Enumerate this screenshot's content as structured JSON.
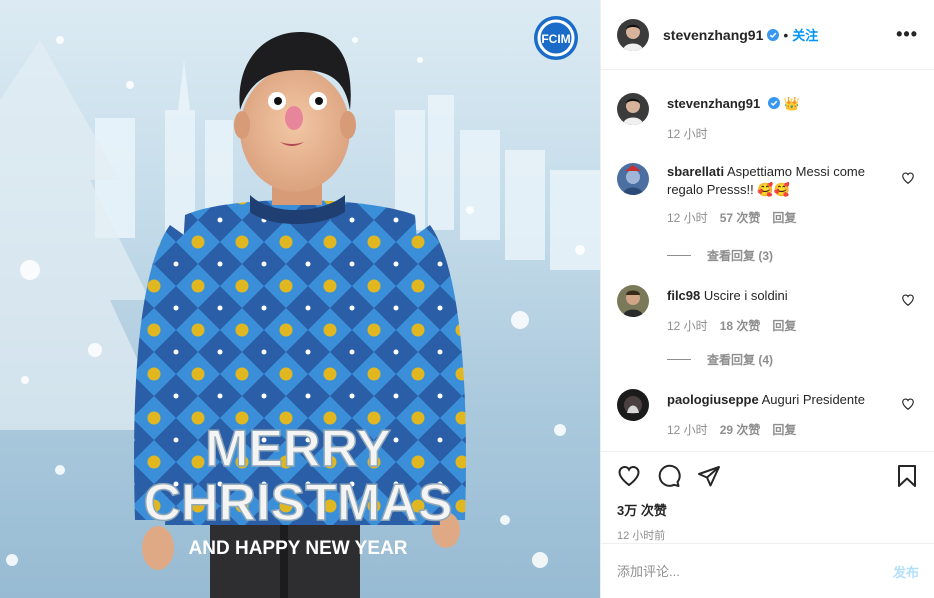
{
  "post": {
    "image": {
      "logo": "FCIM",
      "caption_line1": "MERRY",
      "caption_line2": "CHRISTMAS",
      "caption_line3": "AND HAPPY NEW YEAR"
    }
  },
  "header": {
    "username": "stevenzhang91",
    "separator": "•",
    "follow_label": "关注",
    "more_label": "•••"
  },
  "caption": {
    "username": "stevenzhang91",
    "text": "",
    "emoji": "👑",
    "time": "12 小时"
  },
  "comments": [
    {
      "username": "sbarellati",
      "text": "Aspettiamo Messi come regalo Presss!! 🥰🥰",
      "time": "12 小时",
      "likes": "57 次赞",
      "reply": "回复",
      "view_replies": "查看回复 (3)"
    },
    {
      "username": "filc98",
      "text": "Uscire i soldini",
      "time": "12 小时",
      "likes": "18 次赞",
      "reply": "回复",
      "view_replies": "查看回复 (4)"
    },
    {
      "username": "paologiuseppe",
      "text": "Auguri Presidente",
      "time": "12 小时",
      "likes": "29 次赞",
      "reply": "回复"
    }
  ],
  "actions": {
    "like_icon": "heart-icon",
    "comment_icon": "comment-icon",
    "share_icon": "send-icon",
    "save_icon": "bookmark-icon",
    "likes_total": "3万 次赞",
    "posted_time": "12 小时前"
  },
  "add_comment": {
    "placeholder": "添加评论...",
    "post_label": "发布"
  },
  "colors": {
    "link_blue": "#0095f6",
    "post_disabled": "#b2dffc",
    "muted": "#8e8e8e",
    "text": "#262626",
    "verified": "#3897f0"
  }
}
